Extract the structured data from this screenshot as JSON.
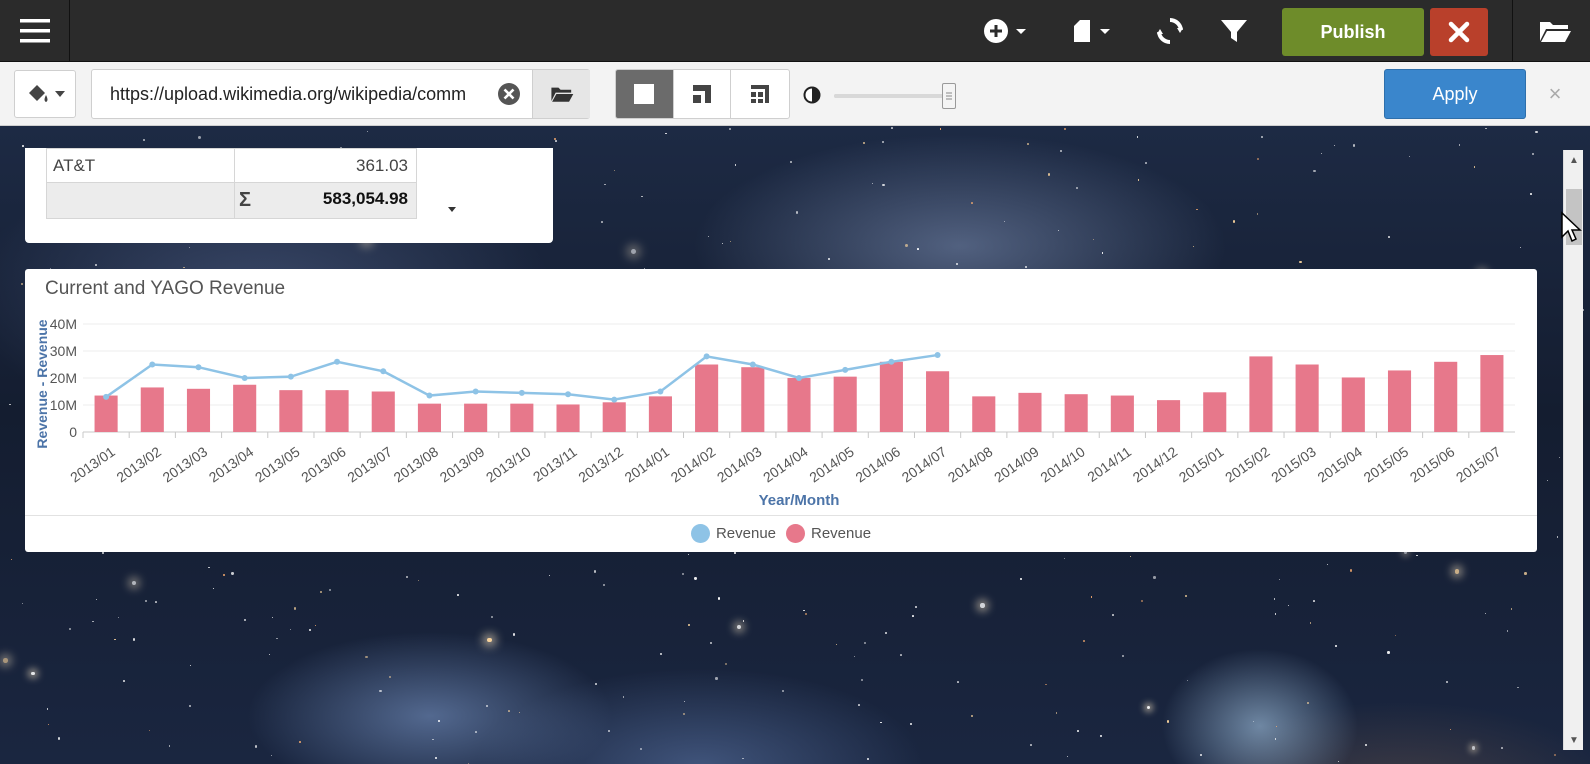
{
  "topbar": {
    "publish_label": "Publish",
    "icons": [
      "menu-icon",
      "add-icon",
      "page-icon",
      "refresh-icon",
      "filter-icon",
      "close-icon",
      "folder-open-icon"
    ]
  },
  "toolbar2": {
    "url_value": "https://upload.wikimedia.org/wikipedia/commons/",
    "apply_label": "Apply",
    "opacity_level": 0.94,
    "close_glyph": "×"
  },
  "colors": {
    "topbar_bg": "#2b2b2b",
    "publish_green": "#6e8c2a",
    "close_red": "#b9402b",
    "apply_blue": "#3a86cc",
    "series_bar": "#e7788b",
    "series_line": "#8ec3e6",
    "axis_label": "#4c74a8"
  },
  "summary_table": {
    "rows": [
      {
        "name": "AT&T",
        "value": "361.03"
      }
    ],
    "total_symbol": "Σ",
    "total_value": "583,054.98"
  },
  "chart": {
    "title": "Current and YAGO Revenue",
    "legend": [
      {
        "label": "Revenue",
        "color": "#8ec3e6"
      },
      {
        "label": "Revenue",
        "color": "#e7788b"
      }
    ]
  },
  "chart_data": {
    "type": "bar",
    "title": "Current and YAGO Revenue",
    "xlabel": "Year/Month",
    "ylabel": "Revenue - Revenue",
    "ylim": [
      0,
      40
    ],
    "yticks": [
      "0",
      "10M",
      "20M",
      "30M",
      "40M"
    ],
    "grid": true,
    "legend_position": "bottom-center",
    "categories": [
      "2013/01",
      "2013/02",
      "2013/03",
      "2013/04",
      "2013/05",
      "2013/06",
      "2013/07",
      "2013/08",
      "2013/09",
      "2013/10",
      "2013/11",
      "2013/12",
      "2014/01",
      "2014/02",
      "2014/03",
      "2014/04",
      "2014/05",
      "2014/06",
      "2014/07",
      "2014/08",
      "2014/09",
      "2014/10",
      "2014/11",
      "2014/12",
      "2015/01",
      "2015/02",
      "2015/03",
      "2015/04",
      "2015/05",
      "2015/06",
      "2015/07"
    ],
    "series": [
      {
        "name": "Revenue",
        "kind": "line",
        "values": [
          13,
          25,
          24,
          20,
          20.5,
          26,
          22.5,
          13.5,
          15,
          14.5,
          14,
          12,
          15,
          28,
          25,
          20,
          23,
          26,
          28.5,
          null,
          null,
          null,
          null,
          null,
          null,
          null,
          null,
          null,
          null,
          null,
          null
        ]
      },
      {
        "name": "Revenue",
        "kind": "bar",
        "values": [
          13.5,
          16.5,
          16,
          17.5,
          15.5,
          15.5,
          15,
          10.5,
          10.5,
          10.5,
          10.2,
          11,
          13.2,
          25,
          24,
          20,
          20.5,
          26,
          22.5,
          13.2,
          14.5,
          14,
          13.5,
          11.8,
          14.7,
          28,
          25,
          20.2,
          22.8,
          26,
          28.5
        ]
      }
    ]
  }
}
